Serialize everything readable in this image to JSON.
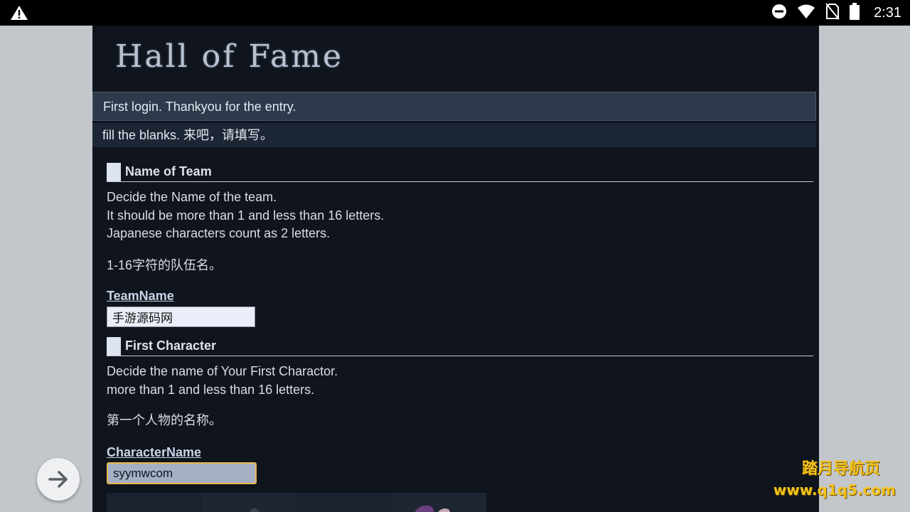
{
  "status_bar": {
    "time": "2:31",
    "left_icon": "warning-icon",
    "right_icons": [
      "do-not-disturb-icon",
      "wifi-icon",
      "no-sim-icon",
      "battery-icon"
    ]
  },
  "page": {
    "logo_text": "Hall of Fame",
    "message_login": "First login. Thankyou for the entry.",
    "message_fill": "fill the blanks. 来吧，请填写。",
    "team_section": {
      "title": "Name of Team",
      "lines": [
        "Decide the Name of the team.",
        "It should be more than 1 and less than 16 letters.",
        "Japanese characters count as 2 letters."
      ],
      "note_cn": "1-16字符的队伍名。",
      "field_label": "TeamName",
      "field_value": "手游源码网"
    },
    "character_section": {
      "title": "First Character",
      "lines": [
        "Decide the name of Your First Charactor.",
        "more than 1 and less than 16 letters."
      ],
      "note_cn": "第一个人物的名称。",
      "field_label": "CharacterName",
      "field_value": "syymwcom"
    }
  },
  "overlay": {
    "watermark_line1": "踏月导航页",
    "watermark_line2": "www.q1q5.com",
    "fab_icon": "arrow-right-icon"
  },
  "colors": {
    "content_bg": "#0f141d",
    "banner_bg": "#2d3a4b",
    "input_focus_border": "#e8b84a",
    "watermark": "#f3c21b"
  }
}
